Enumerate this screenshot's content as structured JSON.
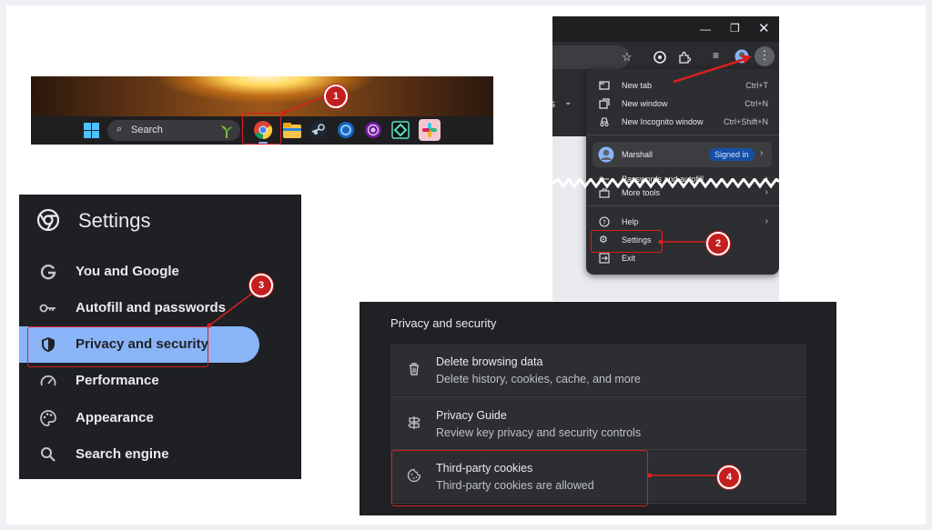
{
  "taskbar": {
    "search_label": "Search"
  },
  "settings": {
    "title": "Settings",
    "items": [
      {
        "label": "You and Google"
      },
      {
        "label": "Autofill and passwords"
      },
      {
        "label": "Privacy and security"
      },
      {
        "label": "Performance"
      },
      {
        "label": "Appearance"
      },
      {
        "label": "Search engine"
      }
    ]
  },
  "chrome_menu": {
    "new_tab": "New tab",
    "new_tab_kb": "Ctrl+T",
    "new_window": "New window",
    "new_window_kb": "Ctrl+N",
    "incognito": "New Incognito window",
    "incognito_kb": "Ctrl+Shift+N",
    "profile_name": "Marshall",
    "signed_in": "Signed in",
    "passwords": "Passwords and autofill",
    "more_tools": "More tools",
    "help": "Help",
    "settings": "Settings",
    "exit": "Exit",
    "page_fragment": "s"
  },
  "privacy": {
    "title": "Privacy and security",
    "rows": [
      {
        "title": "Delete browsing data",
        "subtitle": "Delete history, cookies, cache, and more"
      },
      {
        "title": "Privacy Guide",
        "subtitle": "Review key privacy and security controls"
      },
      {
        "title": "Third-party cookies",
        "subtitle": "Third-party cookies are allowed"
      }
    ]
  },
  "steps": [
    "1",
    "2",
    "3",
    "4"
  ],
  "colors": {
    "annotation": "#d62020",
    "selected": "#8ab4f8",
    "dark_bg": "#202124"
  }
}
